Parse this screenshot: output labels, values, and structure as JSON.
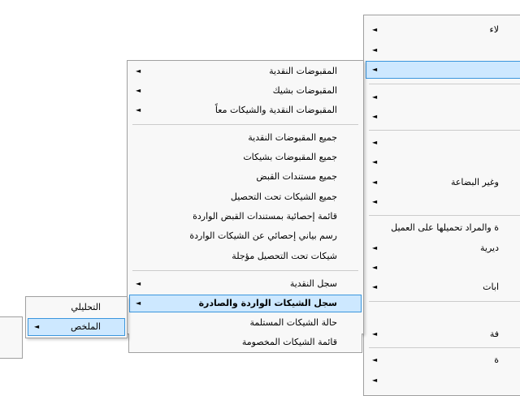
{
  "menu_right": {
    "items": [
      {
        "label": "لاء",
        "arrow": "◄"
      },
      {
        "label": "",
        "arrow": "◄"
      },
      {
        "label": "",
        "arrow": "◄"
      },
      {
        "label": "",
        "arrow": "◄"
      },
      {
        "label": "",
        "arrow": "◄"
      },
      {
        "label": "",
        "arrow": "◄"
      },
      {
        "label": "",
        "arrow": "◄"
      },
      {
        "label": "وغير البضاعة",
        "arrow": "◄"
      },
      {
        "label": "",
        "arrow": "◄"
      },
      {
        "label": "ة والمراد تحميلها على العميل",
        "arrow": ""
      },
      {
        "label": "ديرية",
        "arrow": "◄"
      },
      {
        "label": "",
        "arrow": "◄"
      },
      {
        "label": "ابات",
        "arrow": "◄"
      },
      {
        "label": "",
        "arrow": ""
      },
      {
        "label": "فة",
        "arrow": "◄"
      },
      {
        "label": "ة",
        "arrow": "◄"
      },
      {
        "label": "",
        "arrow": "◄"
      }
    ]
  },
  "menu_receipts": {
    "items": [
      {
        "label": "المقبوضات النقدية",
        "arrow": "◄"
      },
      {
        "label": "المقبوضات بشيك",
        "arrow": "◄"
      },
      {
        "label": "المقبوضات النقدية والشيكات معاً",
        "arrow": "◄"
      },
      {
        "label": "جميع المقبوضات النقدية",
        "arrow": ""
      },
      {
        "label": "جميع المقبوضات بشيكات",
        "arrow": ""
      },
      {
        "label": "جميع مستندات القبض",
        "arrow": ""
      },
      {
        "label": "جميع الشيكات تحت التحصيل",
        "arrow": ""
      },
      {
        "label": "قائمة إحصائية بمستندات القبض الواردة",
        "arrow": ""
      },
      {
        "label": "رسم بياني إحصائي عن الشيكات الواردة",
        "arrow": ""
      },
      {
        "label": "شيكات تحت التحصيل مؤجلة",
        "arrow": ""
      },
      {
        "label": "سجل النقدية",
        "arrow": "◄"
      },
      {
        "label": "سجل الشيكات الواردة والصادرة",
        "arrow": "◄"
      },
      {
        "label": "حالة الشيكات المستلمة",
        "arrow": ""
      },
      {
        "label": "قائمة الشيكات المخصومة",
        "arrow": ""
      }
    ]
  },
  "menu_register": {
    "items": [
      {
        "label": "التحليلي",
        "arrow": ""
      },
      {
        "label": "الملخص",
        "arrow": "◄"
      }
    ]
  }
}
